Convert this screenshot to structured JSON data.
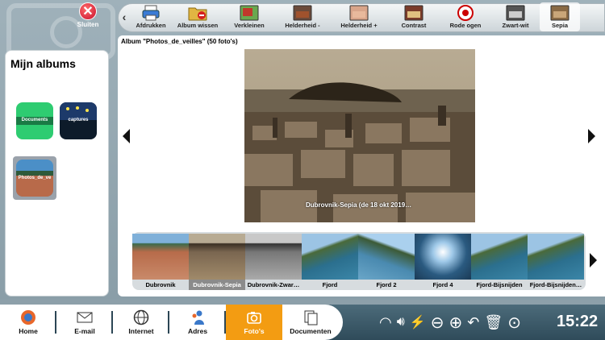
{
  "close": {
    "label": "Sluiten"
  },
  "toolbar": {
    "items": [
      {
        "label": "Afdrukken",
        "icon": "printer-icon"
      },
      {
        "label": "Album wissen",
        "icon": "folder-delete-icon"
      },
      {
        "label": "Verkleinen",
        "icon": "resize-icon"
      },
      {
        "label": "Helderheid -",
        "icon": "brightness-down-icon"
      },
      {
        "label": "Helderheid +",
        "icon": "brightness-up-icon"
      },
      {
        "label": "Contrast",
        "icon": "contrast-icon"
      },
      {
        "label": "Rode ogen",
        "icon": "red-eye-icon"
      },
      {
        "label": "Zwart-wit",
        "icon": "black-white-icon"
      },
      {
        "label": "Sepia",
        "icon": "sepia-icon"
      }
    ]
  },
  "sidebar": {
    "title": "Mijn albums",
    "albums": [
      {
        "label": "Documents",
        "color": "#2ecc71"
      },
      {
        "label": "captures",
        "color": "#111111"
      },
      {
        "label": "Photos_de_ve",
        "color": "#8a9099"
      }
    ]
  },
  "album": {
    "header": "Album \"Photos_de_veilles\" (50 foto's)",
    "caption": "Dubrovnik-Sepia (de 18 okt 2019…"
  },
  "thumbnails": [
    {
      "label": "Dubrovnik",
      "style": "color"
    },
    {
      "label": "Dubrovnik-Sepia",
      "style": "sepia",
      "selected": true
    },
    {
      "label": "Dubrovnik-Zwar…",
      "style": "bw"
    },
    {
      "label": "Fjord",
      "style": "fjord"
    },
    {
      "label": "Fjord 2",
      "style": "fjord2"
    },
    {
      "label": "Fjord 4",
      "style": "fjord4"
    },
    {
      "label": "Fjord-Bijsnijden",
      "style": "fjord"
    },
    {
      "label": "Fjord-Bijsnijden…",
      "style": "fjord"
    }
  ],
  "taskbar": {
    "items": [
      {
        "label": "Home",
        "icon": "home-icon"
      },
      {
        "label": "E-mail",
        "icon": "mail-icon"
      },
      {
        "label": "Internet",
        "icon": "globe-icon"
      },
      {
        "label": "Adres",
        "icon": "contacts-icon"
      },
      {
        "label": "Foto's",
        "icon": "camera-icon",
        "active": true
      },
      {
        "label": "Documenten",
        "icon": "documents-icon"
      }
    ]
  },
  "clock": "15:22",
  "colors": {
    "accent": "#f39c12",
    "taskbar": "#2f4b5a"
  }
}
